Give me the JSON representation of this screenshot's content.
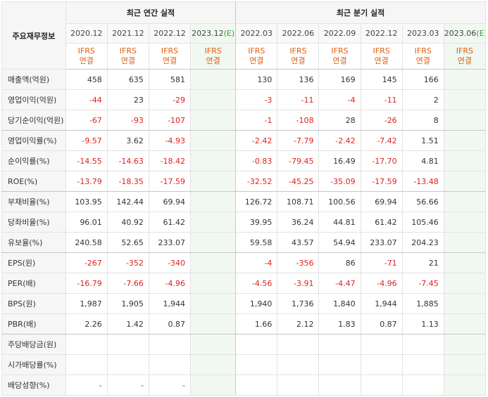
{
  "corner_label": "주요재무정보",
  "groups": {
    "annual": "최근 연간 실적",
    "quarterly": "최근 분기 실적"
  },
  "periods": [
    {
      "label": "2020.12",
      "est": false
    },
    {
      "label": "2021.12",
      "est": false
    },
    {
      "label": "2022.12",
      "est": false
    },
    {
      "label": "2023.12",
      "suffix": "(E)",
      "est": true
    },
    {
      "label": "2022.03",
      "est": false
    },
    {
      "label": "2022.06",
      "est": false
    },
    {
      "label": "2022.09",
      "est": false
    },
    {
      "label": "2022.12",
      "est": false
    },
    {
      "label": "2023.03",
      "est": false
    },
    {
      "label": "2023.06",
      "suffix": "(E)",
      "est": true
    }
  ],
  "basis_line1": "IFRS",
  "basis_line2": "연결",
  "rows": [
    {
      "label": "매출액(억원)",
      "values": [
        "458",
        "635",
        "581",
        "",
        "130",
        "136",
        "169",
        "145",
        "166",
        ""
      ]
    },
    {
      "label": "영업이익(억원)",
      "values": [
        "-44",
        "23",
        "-29",
        "",
        "-3",
        "-11",
        "-4",
        "-11",
        "2",
        ""
      ]
    },
    {
      "label": "당기순이익(억원)",
      "values": [
        "-67",
        "-93",
        "-107",
        "",
        "-1",
        "-108",
        "28",
        "-26",
        "8",
        ""
      ]
    },
    {
      "label": "영업이익률(%)",
      "values": [
        "-9.57",
        "3.62",
        "-4.93",
        "",
        "-2.42",
        "-7.79",
        "-2.42",
        "-7.42",
        "1.51",
        ""
      ]
    },
    {
      "label": "순이익률(%)",
      "values": [
        "-14.55",
        "-14.63",
        "-18.42",
        "",
        "-0.83",
        "-79.45",
        "16.49",
        "-17.70",
        "4.81",
        ""
      ]
    },
    {
      "label": "ROE(%)",
      "values": [
        "-13.79",
        "-18.35",
        "-17.59",
        "",
        "-32.52",
        "-45.25",
        "-35.09",
        "-17.59",
        "-13.48",
        ""
      ]
    },
    {
      "label": "부채비율(%)",
      "values": [
        "103.95",
        "142.44",
        "69.94",
        "",
        "126.72",
        "108.71",
        "100.56",
        "69.94",
        "56.66",
        ""
      ]
    },
    {
      "label": "당좌비율(%)",
      "values": [
        "96.01",
        "40.92",
        "61.42",
        "",
        "39.95",
        "36.24",
        "44.81",
        "61.42",
        "105.46",
        ""
      ]
    },
    {
      "label": "유보율(%)",
      "values": [
        "240.58",
        "52.65",
        "233.07",
        "",
        "59.58",
        "43.57",
        "54.94",
        "233.07",
        "204.23",
        ""
      ]
    },
    {
      "label": "EPS(원)",
      "values": [
        "-267",
        "-352",
        "-340",
        "",
        "-4",
        "-356",
        "86",
        "-71",
        "21",
        ""
      ]
    },
    {
      "label": "PER(배)",
      "values": [
        "-16.79",
        "-7.66",
        "-4.96",
        "",
        "-4.56",
        "-3.91",
        "-4.47",
        "-4.96",
        "-7.45",
        ""
      ]
    },
    {
      "label": "BPS(원)",
      "values": [
        "1,987",
        "1,905",
        "1,944",
        "",
        "1,940",
        "1,736",
        "1,840",
        "1,944",
        "1,885",
        ""
      ]
    },
    {
      "label": "PBR(배)",
      "values": [
        "2.26",
        "1.42",
        "0.87",
        "",
        "1.66",
        "2.12",
        "1.83",
        "0.87",
        "1.13",
        ""
      ]
    },
    {
      "label": "주당배당금(원)",
      "values": [
        "",
        "",
        "",
        "",
        "",
        "",
        "",
        "",
        "",
        ""
      ]
    },
    {
      "label": "시가배당률(%)",
      "values": [
        "",
        "",
        "",
        "",
        "",
        "",
        "",
        "",
        "",
        ""
      ]
    },
    {
      "label": "배당성향(%)",
      "values": [
        "-",
        "-",
        "-",
        "",
        "",
        "",
        "",
        "",
        "",
        ""
      ]
    }
  ],
  "colors": {
    "negative": "#e02020",
    "basis": "#e06010",
    "estimate_bg": "#f1f8f1",
    "estimate_mark": "#3a9a3a"
  }
}
